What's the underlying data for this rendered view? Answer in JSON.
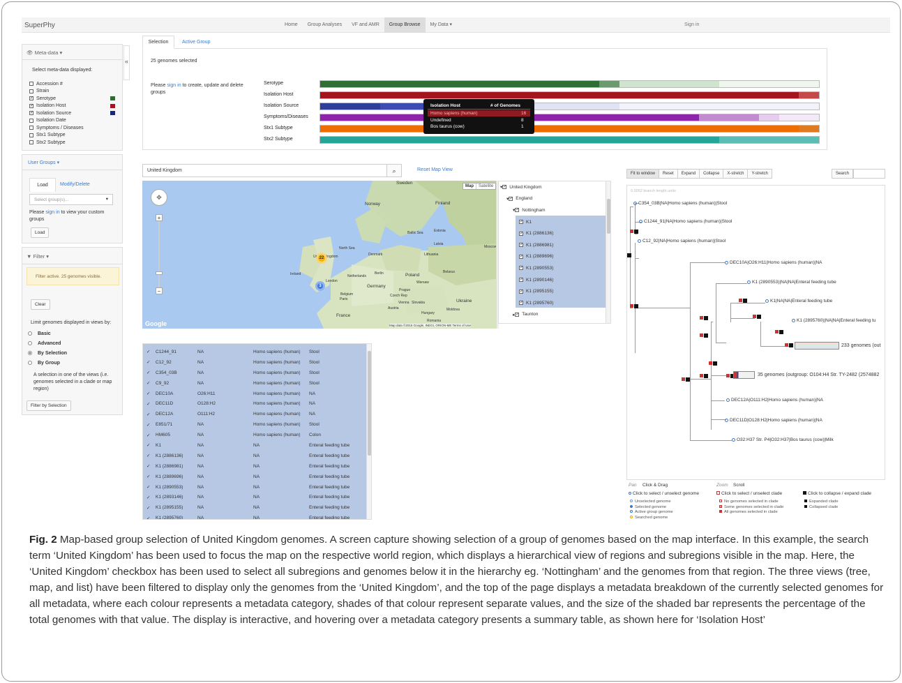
{
  "app": {
    "brand": "SuperPhy",
    "signin": "Sign in"
  },
  "nav": [
    "Home",
    "Group Analyses",
    "VF and AMR",
    "Group Browse",
    "My Data ▾"
  ],
  "sidebar": {
    "meta_header": "Meta-data ▾",
    "meta_prompt": "Select meta-data displayed:",
    "meta_items": [
      {
        "label": "Accession #",
        "checked": false
      },
      {
        "label": "Strain",
        "checked": false
      },
      {
        "label": "Serotype",
        "checked": true,
        "color": "#2e6b2e"
      },
      {
        "label": "Isolation Host",
        "checked": true,
        "color": "#a3141c"
      },
      {
        "label": "Isolation Source",
        "checked": true,
        "color": "#1a237e"
      },
      {
        "label": "Isolation Date",
        "checked": false
      },
      {
        "label": "Symptoms / Diseases",
        "checked": false
      },
      {
        "label": "Stx1 Subtype",
        "checked": false
      },
      {
        "label": "Stx2 Subtype",
        "checked": false
      }
    ],
    "collapse_glyph": "«",
    "user_groups_header": "User Groups ▾",
    "tabs": [
      "Load",
      "Modify/Delete"
    ],
    "select_placeholder": "Select group(s)...",
    "please": "Please",
    "sign_in": "sign in",
    "view_custom": "to view your custom groups",
    "load_button": "Load",
    "filter_header": "Filter ▾",
    "filter_active": "Filter active. 25 genomes visible.",
    "clear": "Clear",
    "limit_label": "Limit genomes displayed in views by:",
    "radio_options": [
      "Basic",
      "Advanced",
      "By Selection",
      "By Group"
    ],
    "selection_note": "A selection in one of the views (i.e. genomes selected in a clade or map region)",
    "filter_button": "Filter by Selection"
  },
  "selection": {
    "tabs": [
      "Selection",
      "Active Group"
    ],
    "count_text": "25 genomes selected",
    "please": "Please",
    "sign_in": "sign in",
    "create_text": "to create, update and delete groups",
    "bar_labels": [
      "Serotype",
      "Isolation Host",
      "Isolation Source",
      "Symptoms/Diseases",
      "Stx1 Subtype",
      "Stx2 Subtype"
    ],
    "bar_segments": [
      [
        {
          "f": 0.56,
          "c": "#2f6f35"
        },
        {
          "f": 0.04,
          "c": "#6b9a6f"
        },
        {
          "f": 0.2,
          "c": "#cfe3cf"
        },
        {
          "f": 0.2,
          "c": "#eef6ee"
        }
      ],
      [
        {
          "f": 0.64,
          "c": "#a3141c"
        },
        {
          "f": 0.32,
          "c": "#a3141c"
        },
        {
          "f": 0.04,
          "c": "#c44a4a"
        }
      ],
      [
        {
          "f": 0.12,
          "c": "#2e3f9a"
        },
        {
          "f": 0.12,
          "c": "#3c4cb0"
        },
        {
          "f": 0.36,
          "c": "#dfe3f3"
        },
        {
          "f": 0.4,
          "c": "#f2f3fa"
        }
      ],
      [
        {
          "f": 0.76,
          "c": "#8e24aa"
        },
        {
          "f": 0.12,
          "c": "#c38ad0"
        },
        {
          "f": 0.04,
          "c": "#e6cdee"
        },
        {
          "f": 0.08,
          "c": "#f4eaf7"
        }
      ],
      [
        {
          "f": 0.96,
          "c": "#ef6c00"
        },
        {
          "f": 0.04,
          "c": "#e07a20"
        }
      ],
      [
        {
          "f": 0.8,
          "c": "#26a69a"
        },
        {
          "f": 0.2,
          "c": "#5cbdb4"
        }
      ]
    ],
    "tooltip": {
      "head": [
        "Isolation Host",
        "# of Genomes"
      ],
      "rows": [
        [
          "Homo sapiens (human)",
          "16"
        ],
        [
          "Undefined",
          "8"
        ],
        [
          "Bos taurus (cow)",
          "1"
        ]
      ]
    }
  },
  "map": {
    "search_value": "United Kingdom",
    "search_icon": "search-icon",
    "reset": "Reset Map View",
    "type_buttons": [
      "Map",
      "Satellite"
    ],
    "labels": [
      "Sweden",
      "Norway",
      "Finland",
      "Estonia",
      "Latvia",
      "Lithuania",
      "Denmark",
      "North Sea",
      "Baltic Sea",
      "Ireland",
      "United Kingdom",
      "Netherlands",
      "London",
      "Belgium",
      "Paris",
      "Germany",
      "Poland",
      "Warsaw",
      "Belarus",
      "Prague",
      "Czech Rep",
      "Vienna",
      "Slovakia",
      "Austria",
      "Hungary",
      "Moldova",
      "Ukraine",
      "France",
      "Romania",
      "Berlin",
      "Moscow"
    ],
    "cluster_labels": [
      "22",
      "3"
    ],
    "google": "Google",
    "attribution": "Map data ©2015 Google, INEGI, ORION-ME   Terms of Use",
    "region_tree": [
      {
        "label": "United Kingdom",
        "level": 0,
        "caret": "▾"
      },
      {
        "label": "England",
        "level": 1,
        "caret": "▾"
      },
      {
        "label": "Nottingham",
        "level": 2,
        "caret": "▾"
      },
      {
        "label": "K1",
        "level": 3,
        "caret": ""
      },
      {
        "label": "K1 (2886136)",
        "level": 3,
        "caret": ""
      },
      {
        "label": "K1 (2886981)",
        "level": 3,
        "caret": ""
      },
      {
        "label": "K1 (2889696)",
        "level": 3,
        "caret": ""
      },
      {
        "label": "K1 (2890553)",
        "level": 3,
        "caret": ""
      },
      {
        "label": "K1 (2890146)",
        "level": 3,
        "caret": ""
      },
      {
        "label": "K1 (2895155)",
        "level": 3,
        "caret": ""
      },
      {
        "label": "K1 (2895760)",
        "level": 3,
        "caret": ""
      },
      {
        "label": "Taunton",
        "level": 2,
        "caret": "▸"
      }
    ]
  },
  "list": {
    "rows": [
      [
        "C1244_91",
        "NA",
        "Homo sapiens (human)",
        "Stool"
      ],
      [
        "C12_92",
        "NA",
        "Homo sapiens (human)",
        "Stool"
      ],
      [
        "C354_03B",
        "NA",
        "Homo sapiens (human)",
        "Stool"
      ],
      [
        "C9_92",
        "NA",
        "Homo sapiens (human)",
        "Stool"
      ],
      [
        "DEC10A",
        "O26:H11",
        "Homo sapiens (human)",
        "NA"
      ],
      [
        "DEC11D",
        "O128:H2",
        "Homo sapiens (human)",
        "NA"
      ],
      [
        "DEC12A",
        "O111:H2",
        "Homo sapiens (human)",
        "NA"
      ],
      [
        "E851/71",
        "NA",
        "Homo sapiens (human)",
        "Stool"
      ],
      [
        "HM605",
        "NA",
        "Homo sapiens (human)",
        "Colon"
      ],
      [
        "K1",
        "NA",
        "NA",
        "Enteral feeding tube"
      ],
      [
        "K1 (2886136)",
        "NA",
        "NA",
        "Enteral feeding tube"
      ],
      [
        "K1 (2886981)",
        "NA",
        "NA",
        "Enteral feeding tube"
      ],
      [
        "K1 (2889696)",
        "NA",
        "NA",
        "Enteral feeding tube"
      ],
      [
        "K1 (2890553)",
        "NA",
        "NA",
        "Enteral feeding tube"
      ],
      [
        "K1 (2893146)",
        "NA",
        "NA",
        "Enteral feeding tube"
      ],
      [
        "K1 (2895155)",
        "NA",
        "NA",
        "Enteral feeding tube"
      ],
      [
        "K1 (2895760)",
        "NA",
        "NA",
        "Enteral feeding tube"
      ]
    ]
  },
  "tree": {
    "buttons": [
      "Fit to window",
      "Reset",
      "Expand",
      "Collapse",
      "X-stretch",
      "Y-stretch"
    ],
    "search_button": "Search",
    "scale": "0.0052 branch length units",
    "leaves": [
      "C354_03B|NA|Homo sapiens (human)|Stool",
      "C1244_91|NA|Homo sapiens (human)|Stool",
      "C12_92|NA|Homo sapiens (human)|Stool",
      "DEC10A|O26:H11|Homo sapiens (human)|NA",
      "K1 (2890553)|NA|NA|Enteral feeding tube",
      "K1|NA|NA|Enteral feeding tube",
      "K1 (2895760)|NA|NA|Enteral feeding tu",
      "233 genomes (out",
      "35 genomes (outgroup: O104:H4 Str. TY-2482 (2574882",
      "DEC12A|O111:H2|Homo sapiens (human)|NA",
      "DEC11D|O128:H2|Homo sapiens (human)|NA",
      "O32:H37 Str. P4|O32:H37|Bos taurus (cow)|Milk"
    ],
    "legend": {
      "pan": "Pan",
      "pan_action": "Click & Drag",
      "zoom": "Zoom",
      "zoom_action": "Scroll",
      "items": [
        "Click to select / unselect genome",
        "Click to select / unselect clade",
        "Click to collapse / expand clade"
      ],
      "col1": [
        "Unselected genome",
        "Selected genome",
        "Active group genome",
        "Searched genome"
      ],
      "col2": [
        "No genomes selected in clade",
        "Some genomes selected in clade",
        "All genomes selected in clade"
      ],
      "col3": [
        "Expanded clade",
        "Collapsed clade"
      ]
    }
  },
  "caption": {
    "label": "Fig. 2",
    "text": "Map-based group selection of United Kingdom genomes. A screen capture showing selection of a group of genomes based on the map interface. In this example, the search term ‘United Kingdom’ has been used to focus the map on the respective world region, which displays a hierarchical view of regions and subregions visible in the map. Here, the ‘United Kingdom’ checkbox has been used to select all subregions and genomes below it in the hierarchy eg. ‘Nottingham’ and the genomes from that region. The three views (tree, map, and list) have been filtered to display only the genomes from the ‘United Kingdom’, and the top of the page displays a metadata breakdown of the currently selected genomes for all metadata, where each colour represents a metadata category, shades of that colour represent separate values, and the size of the shaded bar represents the percentage of the total genomes with that value. The display is interactive, and hovering over a metadata category presents a summary table, as shown here for ‘Isolation Host’"
  }
}
